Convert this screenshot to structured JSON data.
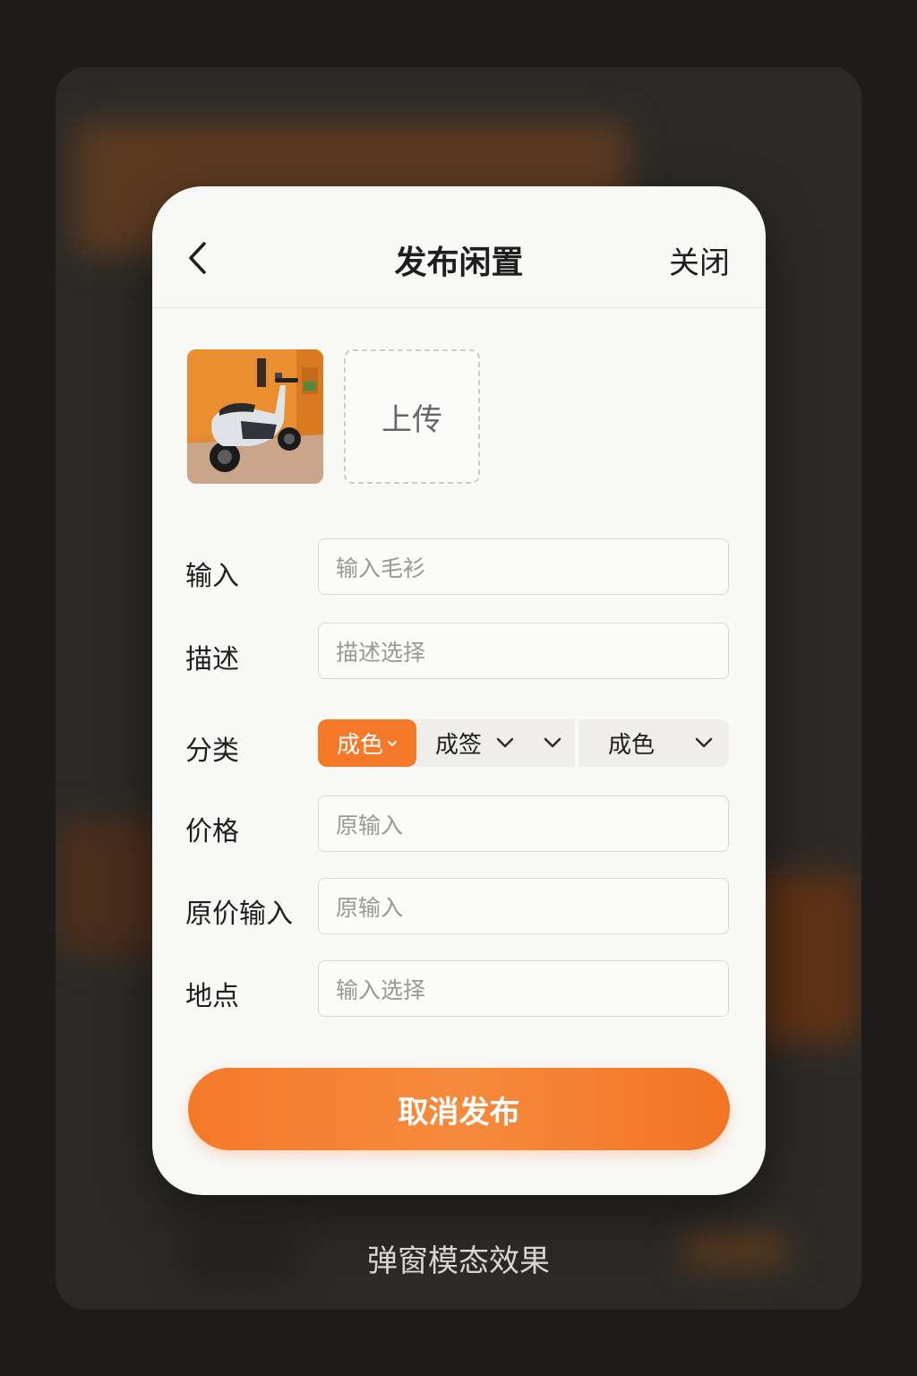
{
  "header": {
    "title": "发布闲置",
    "close_label": "关闭"
  },
  "icons": {
    "back": "chevron-left-icon",
    "dropdown": "chevron-down-icon"
  },
  "photos": {
    "upload_label": "上传"
  },
  "form": {
    "input": {
      "label": "输入",
      "placeholder": "输入毛衫"
    },
    "description": {
      "label": "描述",
      "placeholder": "描述选择"
    },
    "category": {
      "label": "分类",
      "options": [
        "成色",
        "成签",
        "成色"
      ]
    },
    "price": {
      "label": "价格",
      "placeholder": "原输入"
    },
    "original_price": {
      "label": "原价输入",
      "placeholder": "原输入"
    },
    "location": {
      "label": "地点",
      "placeholder": "输入选择"
    }
  },
  "submit_label": "取消发布",
  "caption": "弹窗模态效果",
  "colors": {
    "accent": "#f47a2a",
    "background": "#1d1c1a",
    "modal": "#f8f8f6"
  }
}
